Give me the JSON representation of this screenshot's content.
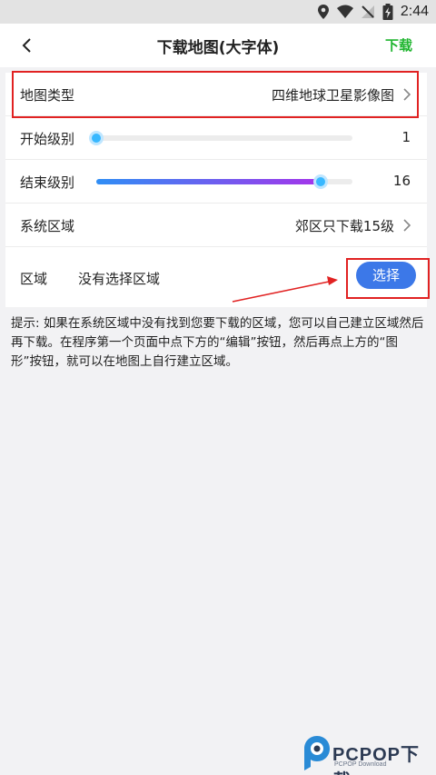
{
  "status_bar": {
    "time": "2:44"
  },
  "header": {
    "title": "下载地图(大字体)",
    "action_label": "下载"
  },
  "map_type": {
    "label": "地图类型",
    "value": "四维地球卫星影像图"
  },
  "start_level": {
    "label": "开始级别",
    "value": "1",
    "fraction": 0.0
  },
  "end_level": {
    "label": "结束级别",
    "value": "16",
    "fraction": 0.875
  },
  "system_area": {
    "label": "系统区域",
    "value": "郊区只下载15级"
  },
  "area": {
    "label": "区域",
    "value": "没有选择区域",
    "button_label": "选择"
  },
  "hint": {
    "text": "提示: 如果在系统区域中没有找到您要下载的区域，您可以自己建立区域然后再下载。在程序第一个页面中点下方的“编辑”按钮，然后再点上方的“图形”按钮，就可以在地图上自行建立区域。"
  },
  "watermark": {
    "text": "PCPOP下载",
    "sub": "PCPOP Download"
  },
  "colors": {
    "accent": "#3c78e8",
    "action_green": "#1fb52f",
    "annotation_red": "#e12222"
  }
}
